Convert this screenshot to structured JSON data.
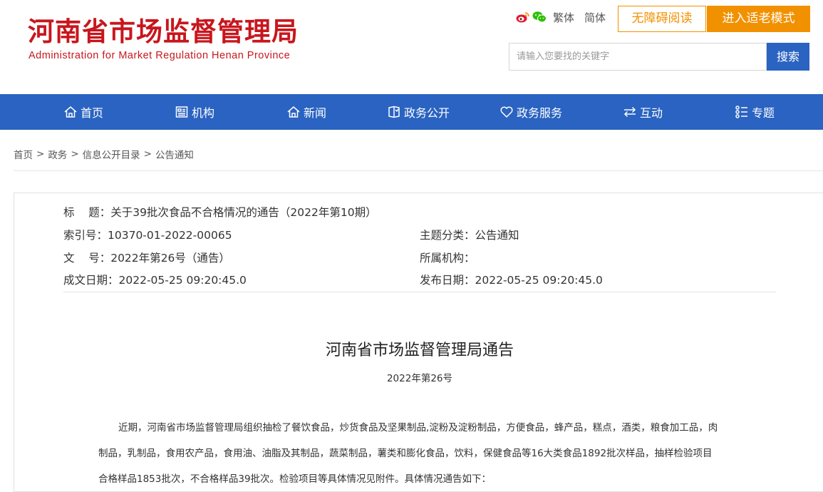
{
  "header": {
    "logo_cn": "河南省市场监督管理局",
    "logo_en": "Administration for Market Regulation Henan Province",
    "tools": {
      "traditional": "繁体",
      "simplified": "简体"
    },
    "access_button": "无障碍阅读",
    "elder_button": "进入适老模式",
    "search": {
      "placeholder": "请输入您要找的关键字",
      "button": "搜索"
    },
    "icons": [
      "weibo-icon",
      "wechat-icon"
    ]
  },
  "nav": {
    "items": [
      {
        "label": "首页",
        "icon": "home-icon"
      },
      {
        "label": "机构",
        "icon": "org-icon"
      },
      {
        "label": "新闻",
        "icon": "news-icon"
      },
      {
        "label": "政务公开",
        "icon": "gov-open-icon"
      },
      {
        "label": "政务服务",
        "icon": "heart-icon"
      },
      {
        "label": "互动",
        "icon": "interact-icon"
      },
      {
        "label": "专题",
        "icon": "topic-icon"
      }
    ]
  },
  "breadcrumb": {
    "items": [
      "首页",
      "政务",
      "信息公开目录",
      "公告通知"
    ],
    "separator": ">"
  },
  "meta": {
    "title": "标    题：关于39批次食品不合格情况的通告（2022年第10期）",
    "index_no": "索引号：10370-01-2022-00065",
    "topic": "主题分类：公告通知",
    "doc_no": "文    号：2022年第26号（通告）",
    "org": "所属机构：",
    "created": "成文日期：2022-05-25 09:20:45.0",
    "published": "发布日期：2022-05-25 09:20:45.0"
  },
  "document": {
    "heading": "河南省市场监督管理局通告",
    "number": "2022年第26号",
    "paragraph_lines": [
      "近期，河南省市场监督管理局组织抽检了餐饮食品，炒货食品及坚果制品,淀粉及淀粉制品，方便食品，蜂产品，糕点，酒类，粮食加工品，肉",
      "制品，乳制品，食用农产品，食用油、油脂及其制品，蔬菜制品，薯类和膨化食品，饮料，保健食品等16大类食品1892批次样品，抽样检验项目",
      "合格样品1853批次，不合格样品39批次。检验项目等具体情况见附件。具体情况通告如下："
    ]
  },
  "colors": {
    "brand_red": "#c8161d",
    "nav_blue": "#2a63c1",
    "accent_orange": "#f29100"
  }
}
